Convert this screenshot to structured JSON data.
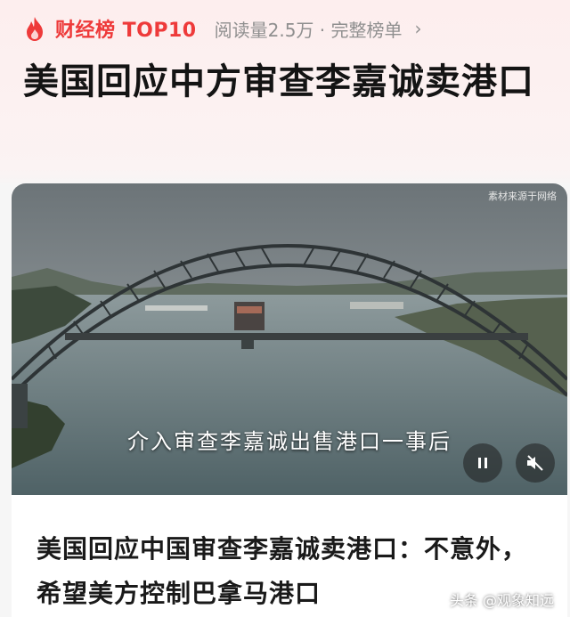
{
  "topbar": {
    "brand": "财经榜 TOP10",
    "reads": "阅读量2.5万 · 完整榜单",
    "chevron": "›",
    "brand_color": "#ee3a3a"
  },
  "headline": "美国回应中方审查李嘉诚卖港口",
  "video": {
    "source_note": "素材来源于网络",
    "subtitle": "介入审查李嘉诚出售港口一事后",
    "pause_icon": "pause-icon",
    "mute_icon": "mute-icon"
  },
  "article": {
    "title": "美国回应中国审查李嘉诚卖港口：不意外，希望美方控制巴拿马港口"
  },
  "watermark": "头条 @观象知远"
}
